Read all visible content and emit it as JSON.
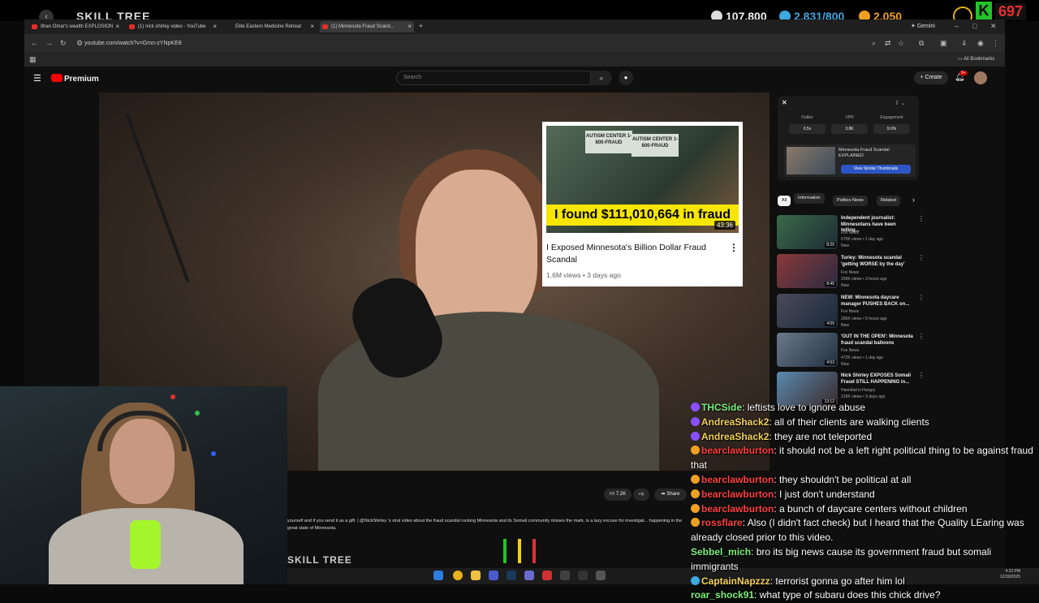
{
  "overlay": {
    "title": "SKILL TREE",
    "stats": [
      {
        "icon": "building-icon",
        "value": "107,800",
        "color": "#ffffff"
      },
      {
        "icon": "coin-icon",
        "value": "2,831/800",
        "color": "#3ea8e0"
      },
      {
        "icon": "gold-icon",
        "value": "2,050",
        "color": "#f0a020"
      }
    ],
    "k_badge": "K",
    "k_count": "697",
    "bottom_title": "SKILL TREE"
  },
  "browser": {
    "tabs": [
      {
        "label": "Ilhan Omar's wealth EXPLOSION",
        "active": false
      },
      {
        "label": "(1) nick shirley video - YouTube",
        "active": false
      },
      {
        "label": "Elite Eastern Medicine Retreat",
        "active": false
      },
      {
        "label": "(1) Minnesota Fraud Scand...",
        "active": true
      }
    ],
    "gemini_label": "Gemini",
    "url": "youtube.com/watch?v=Gmn-zYNpKE8",
    "bookmarks_label": "All Bookmarks"
  },
  "youtube": {
    "logo_label": "Premium",
    "search_placeholder": "Search",
    "create_label": "Create",
    "notif_count": "9+",
    "likes": "7.2K",
    "share_label": "Share",
    "description": "yourself and if you send it as a gift. | @NickShirley 's viral video about the fraud scandal rocking Minnesota and its Somali community misses the mark, is a lazy excuse for investigat... happening in the great state of Minnesota."
  },
  "overlay_card": {
    "sign_text": "AUTISM CENTER 1-800-FRAUD",
    "banner": "I found $111,010,664 in fraud",
    "duration": "43:36",
    "title": "I Exposed Minnesota's Billion Dollar Fraud Scandal",
    "views": "1.6M views",
    "age": "3 days ago"
  },
  "extension": {
    "stats": [
      {
        "label": "Outlier",
        "value": "0.5x"
      },
      {
        "label": "VPH",
        "value": "3.8K"
      },
      {
        "label": "Engagement",
        "value": "9.0%"
      }
    ],
    "similar_title": "Minnesota Fraud Scandal EXPLAINED",
    "similar_button": "View Similar Thumbnails"
  },
  "chips": [
    "All",
    "Information",
    "Politics News",
    "Related"
  ],
  "related": [
    {
      "title": "Independent journalist: Minnesotans have been telling...",
      "channel": "Fox News",
      "meta": "675K views • 1 day ago",
      "badge": "New",
      "duration": "8:25"
    },
    {
      "title": "Turley: Minnesota scandal 'getting WORSE by the day'",
      "channel": "Fox News",
      "meta": "299K views • 3 hours ago",
      "badge": "New",
      "duration": "8:45"
    },
    {
      "title": "NEW: Minnesota daycare manager PUSHES BACK on...",
      "channel": "Fox News",
      "meta": "266K views • 5 hours ago",
      "badge": "New",
      "duration": "4:55"
    },
    {
      "title": "'OUT IN THE OPEN': Minnesota fraud scandal balloons",
      "channel": "Fox News",
      "meta": "472K views • 1 day ago",
      "badge": "New",
      "duration": "4:53"
    },
    {
      "title": "Nick Shirley EXPOSES Somali Fraud STILL HAPPENING in...",
      "channel": "Hannibal is Hungry",
      "meta": "215K views • 3 days ago",
      "badge": "",
      "duration": "13:12"
    }
  ],
  "chat": [
    {
      "user": "THCSide",
      "color": "#7cf07c",
      "badge": "#8a4fff",
      "text": "leftists love to ignore abuse"
    },
    {
      "user": "AndreaShack2",
      "color": "#f4d25a",
      "badge": "#8a4fff",
      "text": "all of their clients are walking clients"
    },
    {
      "user": "AndreaShack2",
      "color": "#f4d25a",
      "badge": "#8a4fff",
      "text": "they are not teleported"
    },
    {
      "user": "bearclawburton",
      "color": "#ff4040",
      "badge": "#f0a020",
      "text": "it should not be a left right political thing to be against fraud that"
    },
    {
      "user": "bearclawburton",
      "color": "#ff4040",
      "badge": "#f0a020",
      "text": "they shouldn't be political at all"
    },
    {
      "user": "bearclawburton",
      "color": "#ff4040",
      "badge": "#f0a020",
      "text": "I just don't understand"
    },
    {
      "user": "bearclawburton",
      "color": "#ff4040",
      "badge": "#f0a020",
      "text": "a bunch of daycare centers without children"
    },
    {
      "user": "rossflare",
      "color": "#ff4040",
      "badge": "#f0a020",
      "text": "Also (I didn't fact check) but I heard that the Quality LEaring was already closed prior to this video."
    },
    {
      "user": "Sebbel_mich",
      "color": "#7cf07c",
      "badge": "",
      "text": "bro its big news cause its government fraud but somali immigrants"
    },
    {
      "user": "CaptainNapzzz",
      "color": "#f4d25a",
      "badge": "#3ea8e0",
      "text": "terrorist gonna go after him lol"
    },
    {
      "user": "roar_shock91",
      "color": "#7cf07c",
      "badge": "",
      "text": "what type of subaru does this chick drive?"
    }
  ],
  "clock": {
    "time": "4:23 PM",
    "date": "12/30/2025"
  }
}
